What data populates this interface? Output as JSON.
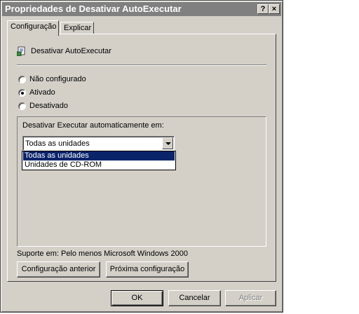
{
  "window": {
    "title": "Propriedades de Desativar AutoExecutar",
    "help_button": "?",
    "close_button": "×"
  },
  "tabs": [
    {
      "label": "Configuração",
      "active": true
    },
    {
      "label": "Explicar",
      "active": false
    }
  ],
  "policy": {
    "name": "Desativar AutoExecutar",
    "icon": "policy-icon"
  },
  "options": {
    "not_configured": {
      "label": "Não configurado",
      "checked": false
    },
    "enabled": {
      "label": "Ativado",
      "checked": true
    },
    "disabled": {
      "label": "Desativado",
      "checked": false
    }
  },
  "group": {
    "label": "Desativar Executar automaticamente em:",
    "combo_value": "Todas as unidades",
    "dropdown_options": [
      "Todas as unidades",
      "Unidades de CD-ROM"
    ],
    "selected_option": "Todas as unidades"
  },
  "support": "Suporte em: Pelo menos Microsoft Windows 2000",
  "nav_buttons": {
    "previous": "Configuração anterior",
    "next": "Próxima configuração"
  },
  "dialog_buttons": {
    "ok": "OK",
    "cancel": "Cancelar",
    "apply": "Aplicar"
  },
  "colors": {
    "face": "#d4d0c8",
    "title_inactive": "#808080",
    "selection": "#0a246a"
  }
}
